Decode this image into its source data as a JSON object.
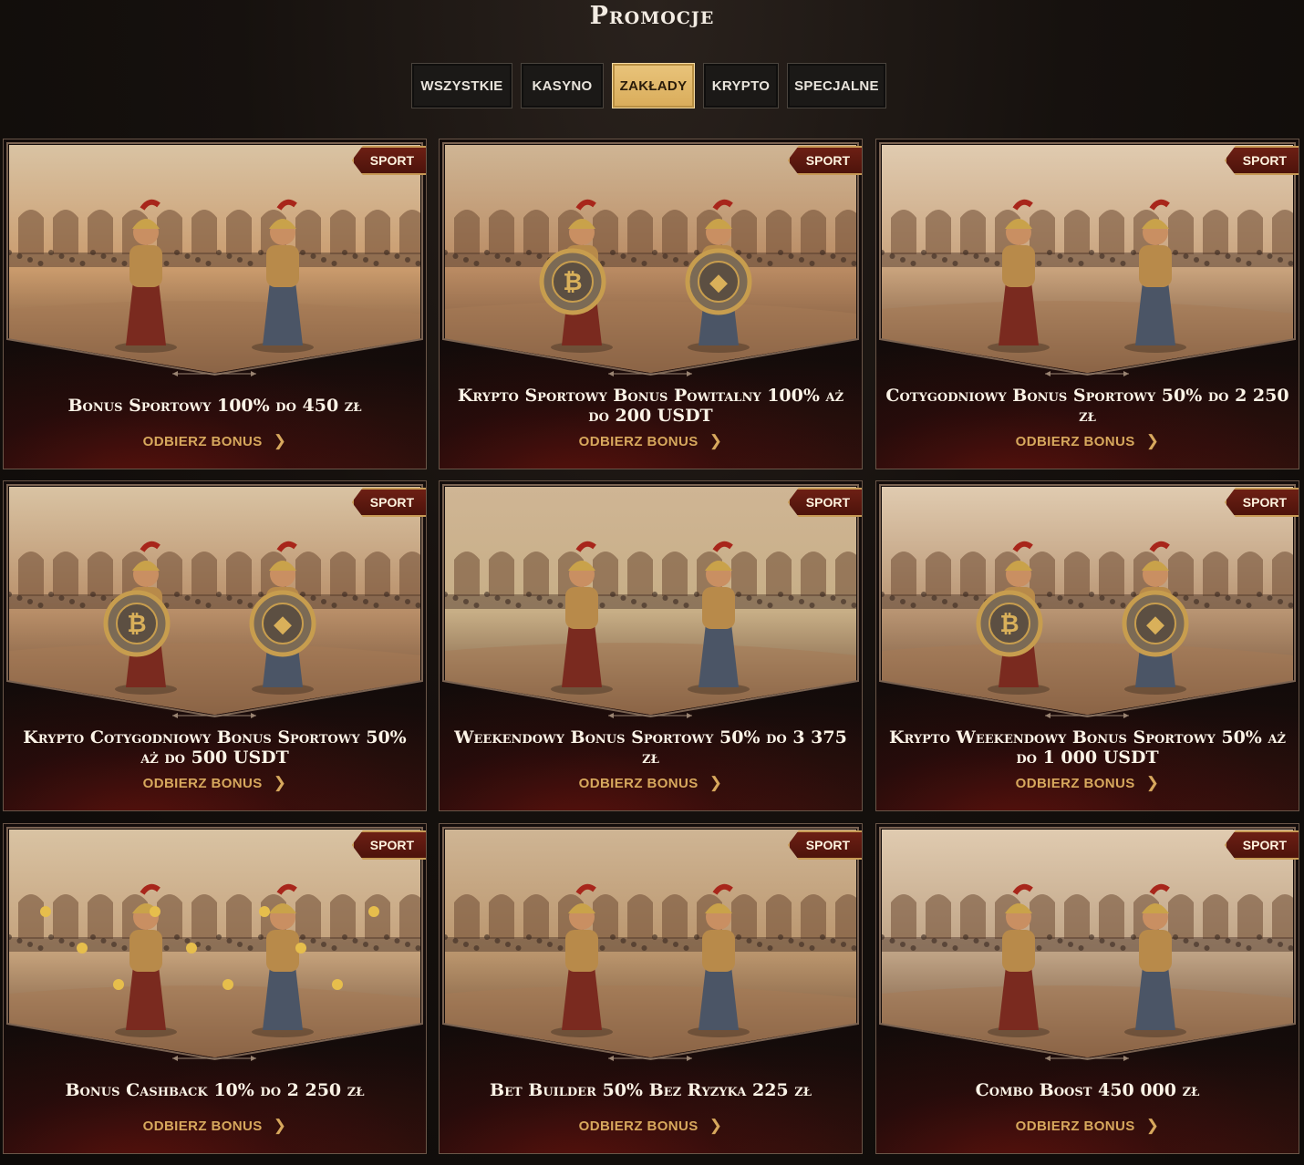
{
  "page": {
    "title": "Promocje"
  },
  "filters": {
    "tabs": [
      {
        "label": "WSZYSTKIE",
        "active": false
      },
      {
        "label": "KASYNO",
        "active": false
      },
      {
        "label": "ZAKŁADY",
        "active": true
      },
      {
        "label": "KRYPTO",
        "active": false
      },
      {
        "label": "SPECJALNE",
        "active": false
      }
    ]
  },
  "promotions": [
    {
      "badge": "SPORT",
      "title": "Bonus Sportowy 100% do 450 zł",
      "cta": "ODBIERZ BONUS",
      "art": "gladiators-charging",
      "tint": "#c99a6c"
    },
    {
      "badge": "SPORT",
      "title": "Krypto Sportowy Bonus Powitalny 100% aż do 200 USDT",
      "cta": "ODBIERZ BONUS",
      "art": "bitcoin-vs-ethereum-shields",
      "tint": "#b98a62"
    },
    {
      "badge": "SPORT",
      "title": "Cotygodniowy Bonus Sportowy 50% do 2 250 zł",
      "cta": "ODBIERZ BONUS",
      "art": "laurel-crowning",
      "tint": "#c8a27c"
    },
    {
      "badge": "SPORT",
      "title": "Krypto Cotygodniowy Bonus Sportowy 50% aż do 500 USDT",
      "cta": "ODBIERZ BONUS",
      "art": "crypto-shields-arena-gate",
      "tint": "#b88e68"
    },
    {
      "badge": "SPORT",
      "title": "Weekendowy Bonus Sportowy 50% do 3 375 zł",
      "cta": "ODBIERZ BONUS",
      "art": "training-ground",
      "tint": "#c7ae86"
    },
    {
      "badge": "SPORT",
      "title": "Krypto Weekendowy Bonus Sportowy 50% aż do 1 000 USDT",
      "cta": "ODBIERZ BONUS",
      "art": "crypto-legion-march",
      "tint": "#b89472"
    },
    {
      "badge": "SPORT",
      "title": "Bonus Cashback 10% do 2 250 zł",
      "cta": "ODBIERZ BONUS",
      "art": "gold-coins-gladiator",
      "tint": "#c3a07a"
    },
    {
      "badge": "SPORT",
      "title": "Bet Builder 50% Bez Ryzyka 225 zł",
      "cta": "ODBIERZ BONUS",
      "art": "strategy-scroll",
      "tint": "#b9946c"
    },
    {
      "badge": "SPORT",
      "title": "Combo Boost 450 000 zł",
      "cta": "ODBIERZ BONUS",
      "art": "rider-and-horse",
      "tint": "#bea284"
    }
  ]
}
